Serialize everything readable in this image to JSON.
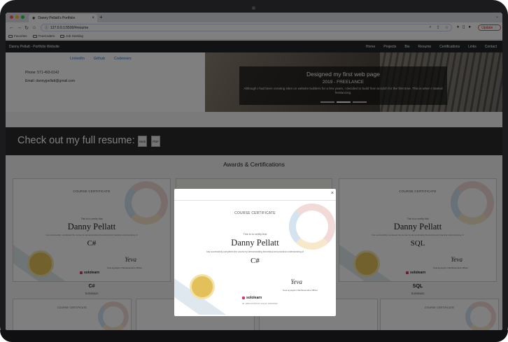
{
  "browser": {
    "tab_title": "Danny Pellatt's Portfolio",
    "tab_close": "×",
    "new_tab": "+",
    "tab_menu": "⌄",
    "url": "127.0.0.1:5500/#resume",
    "nav": {
      "back": "←",
      "forward": "→",
      "reload": "↻",
      "home": "⌂"
    },
    "omni_icons": {
      "zoom": "⌕",
      "share": "⇪",
      "star": "☆"
    },
    "tool_icons": {
      "pin": "♦",
      "split": "▯",
      "profile": "●"
    },
    "update_label": "Update ⋮",
    "bookmarks": [
      "Favorites",
      "TrueCoders",
      "Job Seeking"
    ],
    "colors": {
      "close": "#ff5f57",
      "minimize": "#febc2e",
      "maximize": "#28c840"
    }
  },
  "site": {
    "brand": "Danny Pellatt - Portfolio Website",
    "nav": [
      "Home",
      "Projects",
      "Bio",
      "Resume",
      "Certifications",
      "Links",
      "Contact"
    ]
  },
  "contact": {
    "links": [
      "LinkedIn",
      "Github",
      "Codewars"
    ],
    "phone": "Phone: 571-493-0142",
    "email": "Email: dannyjpellatt@gmail.com"
  },
  "carousel": {
    "title": "Designed my first web page",
    "subtitle": "2019 - FREELANCE",
    "text": "Although I had been creating sites on website builders for a few years, I decided to build from scratch for the first time. This is when I started freelancing."
  },
  "resume": {
    "heading": "Check out my full resume:",
    "buttons": [
      "Web",
      "PDF"
    ]
  },
  "awards": {
    "heading": "Awards & Certifications",
    "cards": [
      {
        "label": "C#",
        "issuer": "Sololearn"
      },
      {
        "label": "SQL",
        "issuer": "Sololearn"
      }
    ]
  },
  "certificate": {
    "title": "COURSE CERTIFICATE",
    "certify": "This is to certify that",
    "name": "Danny Pellatt",
    "description": "has successfully completed the course by demonstrating theoretical and practical understanding of",
    "course_modal": "C#",
    "course_left": "C#",
    "course_right": "SQL",
    "signer": "Yeva Hyusyan Chief Executive Officer",
    "brand": "sololearn",
    "signature": "Yeva",
    "footnote": "ID: 1059-2XXXXXXX Issued: 04/03/2022"
  },
  "modal": {
    "close": "×"
  }
}
